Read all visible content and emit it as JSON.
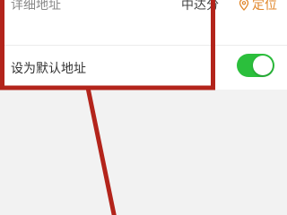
{
  "address_row": {
    "label": "详细地址",
    "value": "中达分",
    "locate_label": "定位",
    "locate_icon": "location-pin-icon"
  },
  "default_row": {
    "label": "设为默认地址",
    "toggle_on": true,
    "toggle_color": "#2bbf3c"
  },
  "annotation": {
    "color": "#b3241b"
  }
}
